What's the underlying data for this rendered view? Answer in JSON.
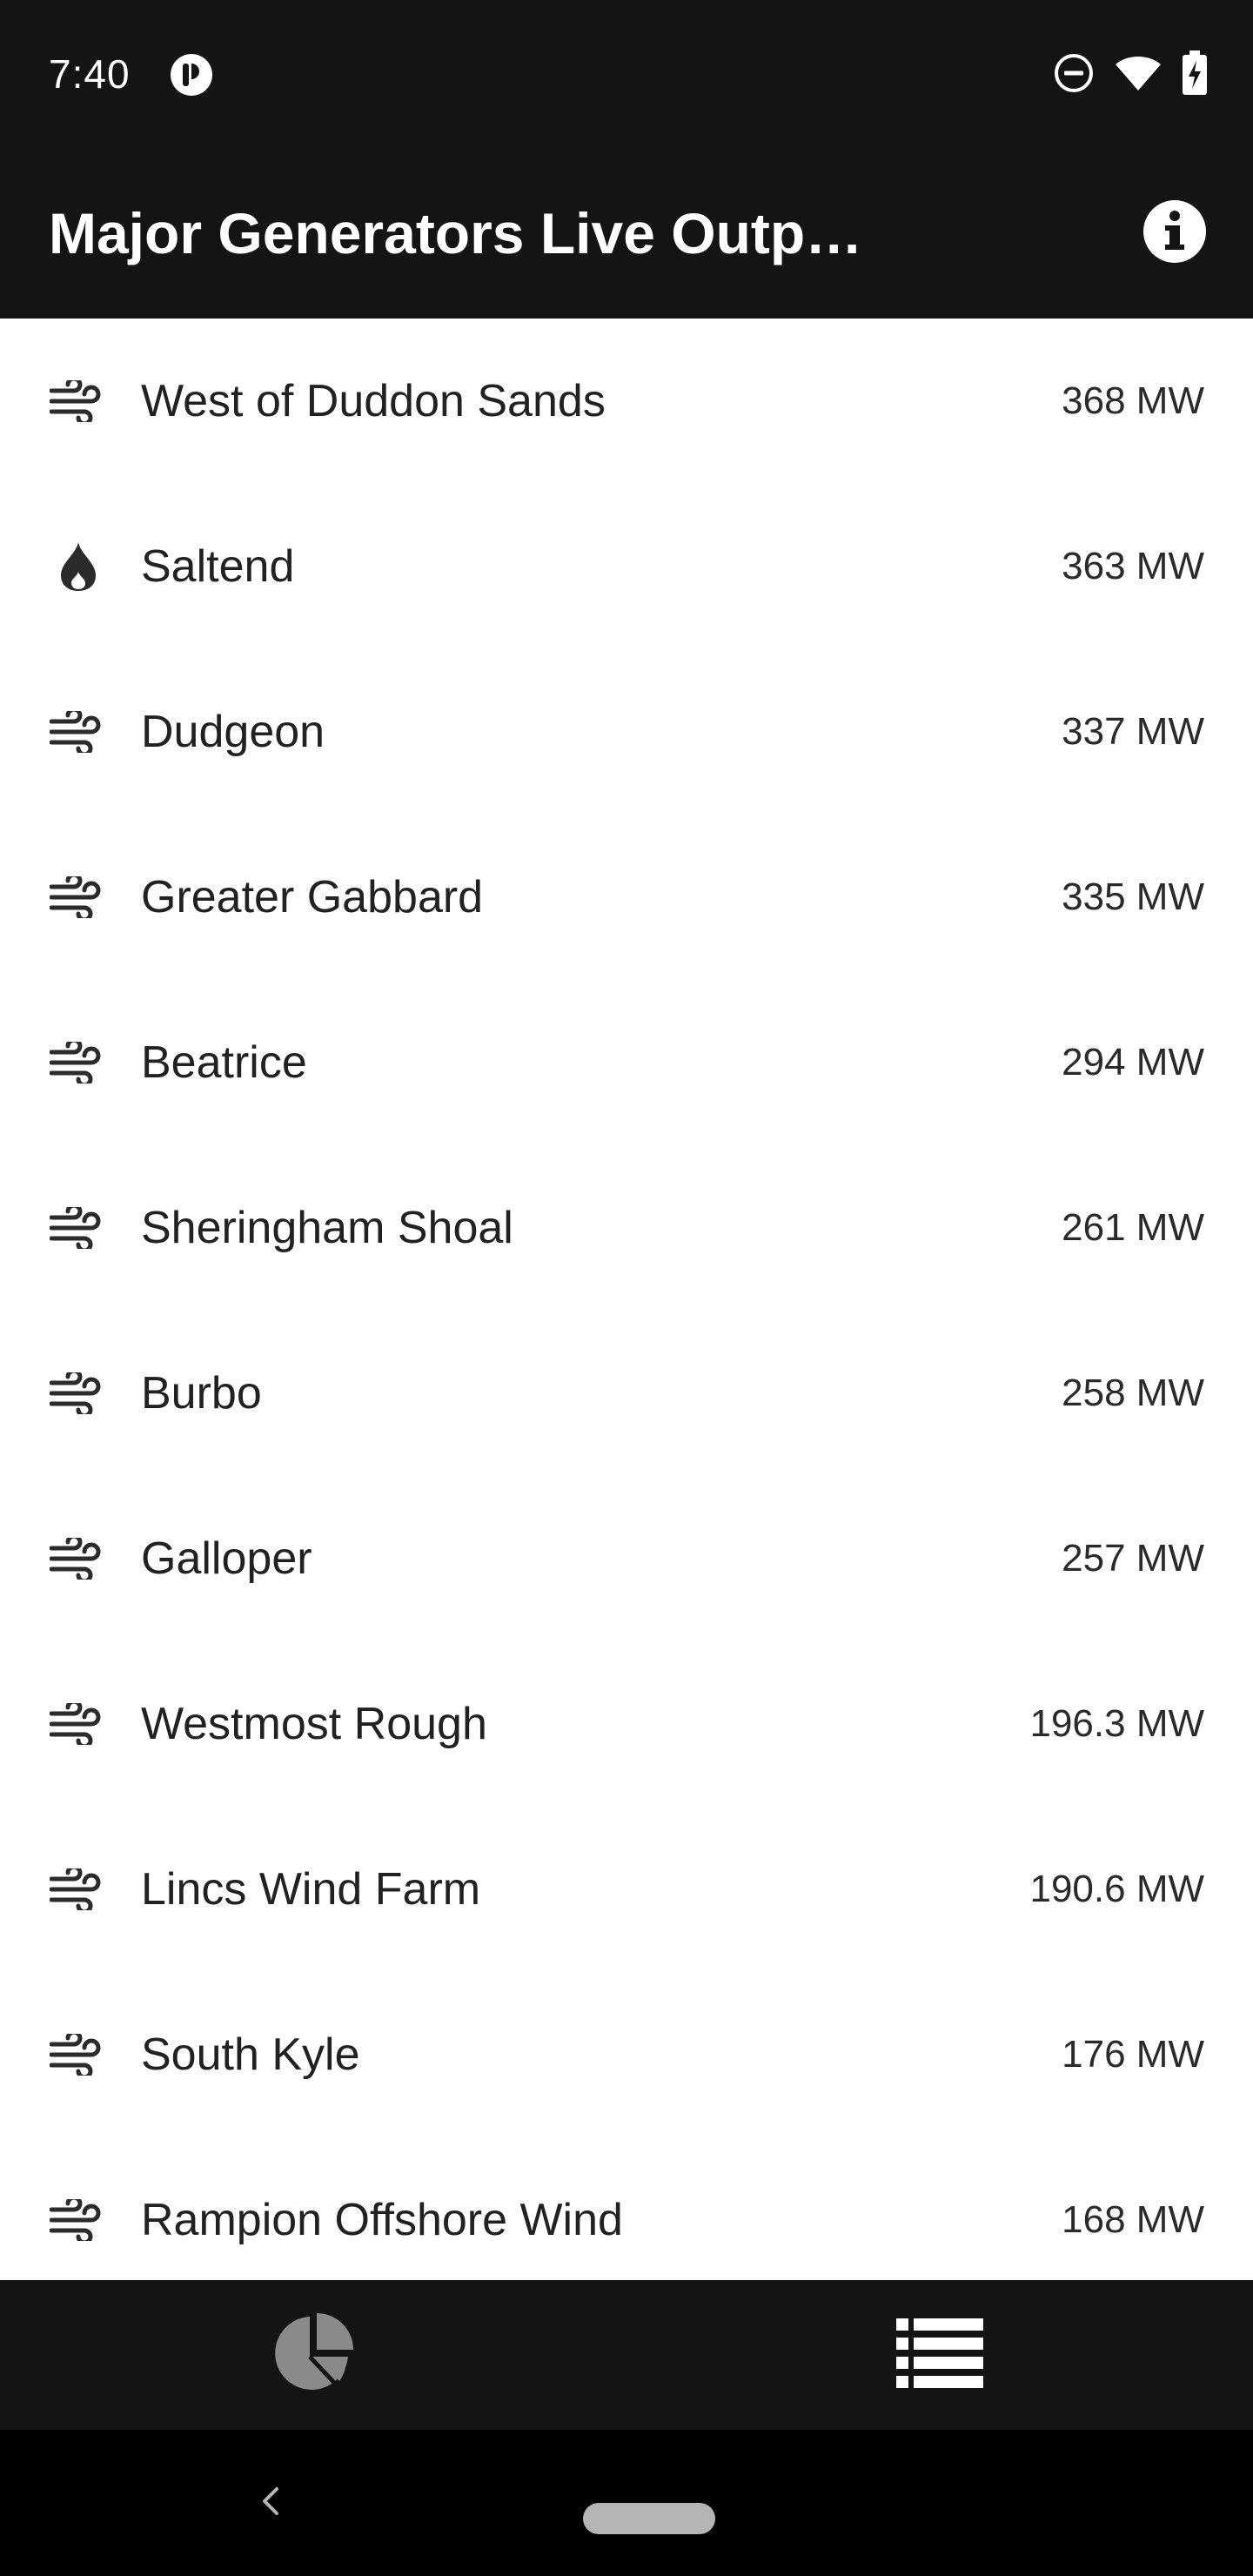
{
  "status_bar": {
    "time": "7:40",
    "icons": [
      "app-notification-icon",
      "do-not-disturb-icon",
      "wifi-icon",
      "battery-charging-icon"
    ]
  },
  "app_bar": {
    "title": "Major Generators Live Output…",
    "action_icon": "info-icon"
  },
  "generators": [
    {
      "icon": "wind-icon",
      "name": "West of Duddon Sands",
      "output": "368 MW"
    },
    {
      "icon": "flame-icon",
      "name": "Saltend",
      "output": "363 MW"
    },
    {
      "icon": "wind-icon",
      "name": "Dudgeon",
      "output": "337 MW"
    },
    {
      "icon": "wind-icon",
      "name": "Greater Gabbard",
      "output": "335 MW"
    },
    {
      "icon": "wind-icon",
      "name": "Beatrice",
      "output": "294 MW"
    },
    {
      "icon": "wind-icon",
      "name": "Sheringham Shoal",
      "output": "261 MW"
    },
    {
      "icon": "wind-icon",
      "name": "Burbo",
      "output": "258 MW"
    },
    {
      "icon": "wind-icon",
      "name": "Galloper",
      "output": "257 MW"
    },
    {
      "icon": "wind-icon",
      "name": "Westmost Rough",
      "output": "196.3 MW"
    },
    {
      "icon": "wind-icon",
      "name": "Lincs Wind Farm",
      "output": "190.6 MW"
    },
    {
      "icon": "wind-icon",
      "name": "South Kyle",
      "output": "176 MW"
    },
    {
      "icon": "wind-icon",
      "name": "Rampion Offshore Wind",
      "output": "168 MW"
    }
  ],
  "bottom_nav": {
    "tabs": [
      {
        "icon": "pie-chart-icon",
        "selected": false
      },
      {
        "icon": "list-icon",
        "selected": true
      }
    ]
  },
  "colors": {
    "bar_background": "#141414",
    "list_background": "#ffffff",
    "icon_dark": "#2b2b2b",
    "nav_inactive": "#8a8a8a",
    "nav_active": "#ffffff"
  }
}
